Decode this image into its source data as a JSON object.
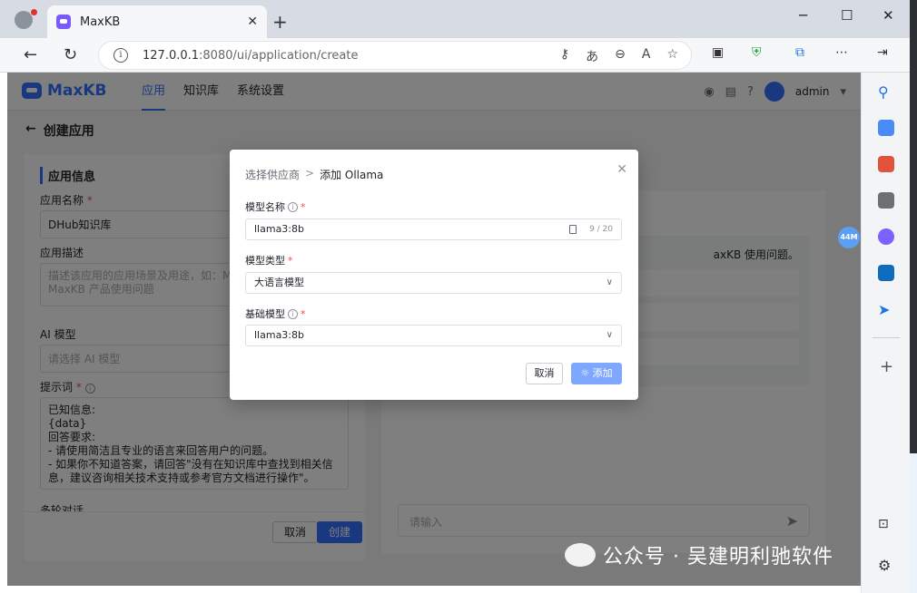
{
  "browser": {
    "tab_title": "MaxKB",
    "url_host": "127.0.0.1",
    "url_rest": ":8080/ui/application/create"
  },
  "app": {
    "logo": "MaxKB",
    "nav": [
      "应用",
      "知识库",
      "系统设置"
    ],
    "user": "admin",
    "page_title": "创建应用",
    "section_title": "应用信息",
    "fields": {
      "name_label": "应用名称",
      "name_value": "DHub知识库",
      "desc_label": "应用描述",
      "desc_placeholder": "描述该应用的应用场景及用途，如：MaxKB\nMaxKB 产品使用问题",
      "ai_model_label": "AI 模型",
      "ai_model_placeholder": "请选择 AI 模型",
      "prompt_label": "提示词",
      "prompt_text": "已知信息:\n{data}\n回答要求:\n- 请使用简洁且专业的语言来回答用户的问题。\n- 如果你不知道答案，请回答\"没有在知识库中查找到相关信息，建议咨询相关技术支持或参考官方文档进行操作\"。",
      "multi_turn_label": "多轮对话"
    },
    "buttons": {
      "cancel": "取消",
      "create": "创建"
    },
    "chat": {
      "greeting_fragment": "axKB 使用问题。",
      "input_placeholder": "请输入"
    }
  },
  "dialog": {
    "crumb_prev": "选择供应商",
    "crumb_sep": ">",
    "crumb_current": "添加 Ollama",
    "model_name_label": "模型名称",
    "model_name_value": "llama3:8b",
    "model_name_counter": "9 / 20",
    "model_type_label": "模型类型",
    "model_type_value": "大语言模型",
    "base_model_label": "基础模型",
    "base_model_value": "llama3:8b",
    "cancel": "取消",
    "add": "添加"
  },
  "sidebar_badge": "44M",
  "watermark": "公众号 · 吴建明利驰软件"
}
